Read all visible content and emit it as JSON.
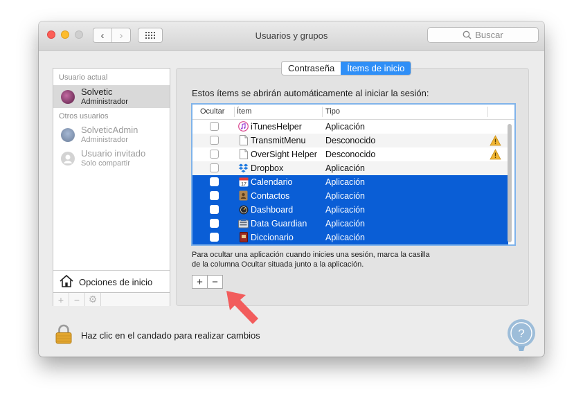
{
  "window": {
    "title": "Usuarios y grupos"
  },
  "search": {
    "placeholder": "Buscar"
  },
  "sidebar": {
    "current_user_header": "Usuario actual",
    "other_users_header": "Otros usuarios",
    "current_user": {
      "name": "Solvetic",
      "role": "Administrador"
    },
    "other_users": [
      {
        "name": "SolveticAdmin",
        "role": "Administrador"
      },
      {
        "name": "Usuario invitado",
        "role": "Solo compartir"
      }
    ],
    "login_options": "Opciones de inicio"
  },
  "tabs": [
    {
      "label": "Contraseña",
      "active": false
    },
    {
      "label": "Ítems de inicio",
      "active": true
    }
  ],
  "login_items": {
    "description": "Estos ítems se abrirán automáticamente al iniciar la sesión:",
    "columns": [
      "Ocultar",
      "Ítem",
      "Tipo"
    ],
    "rows": [
      {
        "item": "iTunesHelper",
        "type": "Aplicación",
        "icon": "itunes-icon",
        "selected": false,
        "warning": false
      },
      {
        "item": "TransmitMenu",
        "type": "Desconocido",
        "icon": "document-icon",
        "selected": false,
        "warning": true
      },
      {
        "item": "OverSight Helper",
        "type": "Desconocido",
        "icon": "document-icon",
        "selected": false,
        "warning": true
      },
      {
        "item": "Dropbox",
        "type": "Aplicación",
        "icon": "dropbox-icon",
        "selected": false,
        "warning": false
      },
      {
        "item": "Calendario",
        "type": "Aplicación",
        "icon": "calendar-icon",
        "selected": true,
        "warning": false
      },
      {
        "item": "Contactos",
        "type": "Aplicación",
        "icon": "contacts-icon",
        "selected": true,
        "warning": false
      },
      {
        "item": "Dashboard",
        "type": "Aplicación",
        "icon": "dashboard-icon",
        "selected": true,
        "warning": false
      },
      {
        "item": "Data Guardian",
        "type": "Aplicación",
        "icon": "data-guardian-icon",
        "selected": true,
        "warning": false
      },
      {
        "item": "Diccionario",
        "type": "Aplicación",
        "icon": "dictionary-icon",
        "selected": true,
        "warning": false
      }
    ],
    "hint_line1": "Para ocultar una aplicación cuando inicies una sesión, marca la casilla",
    "hint_line2": "de la columna Ocultar situada junto a la aplicación.",
    "add_label": "+",
    "remove_label": "−"
  },
  "footer": {
    "lock_text": "Haz clic en el candado para realizar cambios"
  },
  "colors": {
    "selection": "#0a5ed6",
    "tab_active": "#2f8ff7",
    "arrow": "#f25c5c",
    "badge": "#8fb5d6"
  }
}
